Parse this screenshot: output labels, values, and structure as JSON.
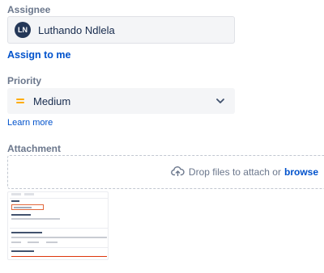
{
  "assignee": {
    "label": "Assignee",
    "avatar_initials": "LN",
    "name": "Luthando Ndlela",
    "assign_to_me": "Assign to me"
  },
  "priority": {
    "label": "Priority",
    "value": "Medium",
    "icon": "medium-priority-icon",
    "learn_more": "Learn more"
  },
  "attachment": {
    "label": "Attachment",
    "drop_text": "Drop files to attach or",
    "browse": "browse",
    "thumbnail": "attachment-thumbnail"
  },
  "colors": {
    "link": "#0052cc",
    "label": "#6b778c",
    "avatar_bg": "#253858",
    "priority_medium": "#ffab00"
  }
}
